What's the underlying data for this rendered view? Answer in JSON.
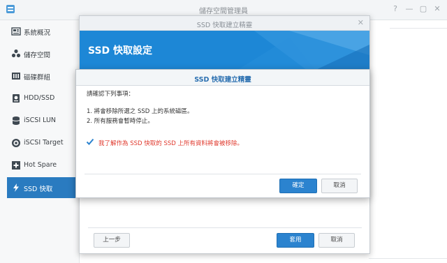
{
  "window": {
    "title": "儲存空間管理員"
  },
  "sidebar": {
    "items": [
      {
        "label": "系統概況",
        "icon": "overview-icon"
      },
      {
        "label": "儲存空間",
        "icon": "storage-icon"
      },
      {
        "label": "磁碟群組",
        "icon": "disk-group-icon"
      },
      {
        "label": "HDD/SSD",
        "icon": "hdd-icon"
      },
      {
        "label": "iSCSI LUN",
        "icon": "database-icon"
      },
      {
        "label": "iSCSI Target",
        "icon": "target-icon"
      },
      {
        "label": "Hot Spare",
        "icon": "plus-box-icon"
      },
      {
        "label": "SSD 快取",
        "icon": "lightning-icon",
        "active": true
      }
    ]
  },
  "wizard": {
    "title": "SSD 快取建立精靈",
    "heading": "SSD 快取設定",
    "back_label": "上一步",
    "apply_label": "套用",
    "cancel_label": "取消"
  },
  "dialog": {
    "title": "SSD 快取建立精靈",
    "intro": "請確認下列事項：",
    "items": [
      "1. 將會移除所選之 SSD 上的系統磁區。",
      "2. 所有服務會暫時停止。"
    ],
    "checkbox_label": "我了解作為 SSD 快取的 SSD 上所有資料將會被移除。",
    "checkbox_checked": true,
    "ok_label": "確定",
    "cancel_label": "取消"
  },
  "colors": {
    "accent": "#2b83cf",
    "banner": "#1d87d6",
    "warning_text": "#e0392d"
  }
}
